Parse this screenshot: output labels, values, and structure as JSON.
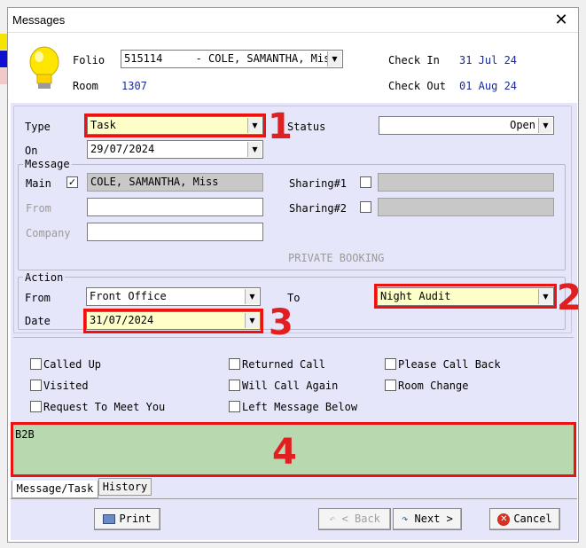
{
  "window": {
    "title": "Messages"
  },
  "header": {
    "folio_label": "Folio",
    "folio_value": "515114",
    "guest_name": "- COLE, SAMANTHA, Miss",
    "room_label": "Room",
    "room_value": "1307",
    "check_in_label": "Check In",
    "check_in_value": "31 Jul 24",
    "check_out_label": "Check Out",
    "check_out_value": "01 Aug 24"
  },
  "form": {
    "type_label": "Type",
    "type_value": "Task",
    "status_label": "Status",
    "status_value": "Open",
    "on_label": "On",
    "on_value": "29/07/2024"
  },
  "message_group": {
    "title": "Message",
    "main_label": "Main",
    "main_checked": true,
    "main_value": "COLE, SAMANTHA, Miss",
    "from_label": "From",
    "from_value": "",
    "company_label": "Company",
    "company_value": "",
    "sharing1_label": "Sharing#1",
    "sharing2_label": "Sharing#2",
    "private_text": "PRIVATE BOOKING"
  },
  "action_group": {
    "title": "Action",
    "from_label": "From",
    "from_value": "Front Office",
    "to_label": "To",
    "to_value": "Night Audit",
    "date_label": "Date",
    "date_value": "31/07/2024"
  },
  "checkboxes": {
    "called_up": "Called Up",
    "visited": "Visited",
    "request_meet": "Request To Meet You",
    "returned_call": "Returned Call",
    "will_call_again": "Will Call Again",
    "left_message": "Left Message Below",
    "please_call_back": "Please Call Back",
    "room_change": "Room Change"
  },
  "message_text": "B2B",
  "tabs": {
    "message_task": "Message/Task",
    "history": "History"
  },
  "buttons": {
    "print": "Print",
    "back": "< Back",
    "next": "Next >",
    "cancel": "Cancel"
  },
  "annotations": {
    "n1": "1",
    "n2": "2",
    "n3": "3",
    "n4": "4"
  },
  "colors": {
    "panel": "#e6e6fb",
    "highlight": "#fefec8",
    "note_area": "#b8d8b0",
    "annotation_red": "#ee1111",
    "header_value_blue": "#1a2a9e"
  }
}
